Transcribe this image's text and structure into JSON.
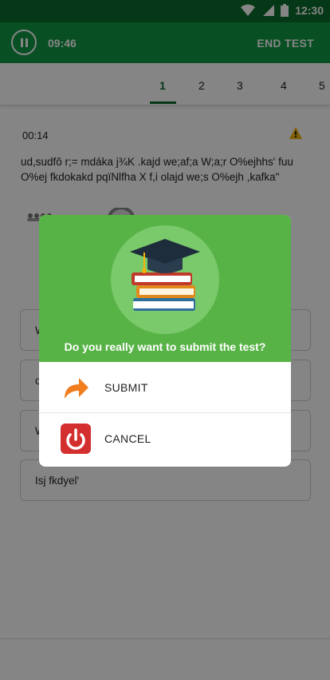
{
  "status_bar": {
    "time": "12:30",
    "icons": [
      "wifi-icon",
      "signal-icon",
      "battery-icon"
    ]
  },
  "top_bar": {
    "timer": "09:46",
    "end_label": "END TEST"
  },
  "tabs": [
    "1",
    "2",
    "3",
    "4",
    "5"
  ],
  "question": {
    "time": "00:14",
    "text": "ud,sudfô r;= mdáka j¾K .kajd we;af;a W;a;r O%ejhhs' fuu O%ej fkdokakd pqïNlfha X f,i olajd we;s O%ejh ,kafka\""
  },
  "options": [
    "W",
    "o",
    "W",
    "Isj fkdyel'"
  ],
  "dialog": {
    "question": "Do you really want to submit the test?",
    "submit_label": "SUBMIT",
    "cancel_label": "CANCEL"
  },
  "colors": {
    "status_bar": "#0b6b2c",
    "app_bar": "#119a44",
    "dialog_header": "#58b347",
    "cancel_red": "#d32f2f",
    "submit_orange": "#f07d1e"
  }
}
